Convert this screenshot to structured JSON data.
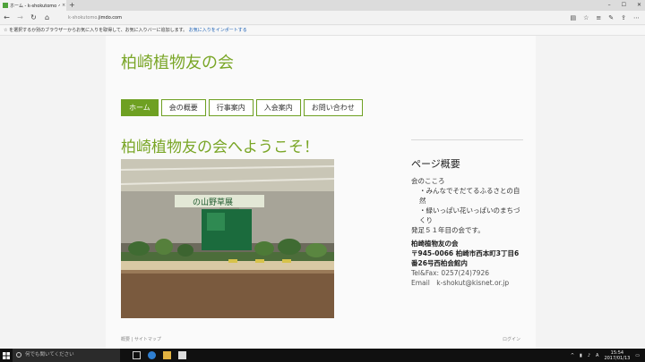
{
  "browser": {
    "tab_title": "ホーム - k-shokutomo ペ",
    "tab_close": "×",
    "new_tab": "+",
    "address_prefix": "k-shokutomo.",
    "address_domain": "jimdo.com",
    "favbar_text": "を選択するか別のブラウザーからお気に入りを取得して、お気に入りバーに追加します。",
    "favbar_link": "お気に入りをインポートする",
    "win_min": "–",
    "win_max": "☐",
    "win_close": "✕"
  },
  "site": {
    "title": "柏崎植物友の会",
    "menu": [
      "ホーム",
      "会の概要",
      "行事案内",
      "入会案内",
      "お問い合わせ"
    ],
    "heading": "柏崎植物友の会へようこそ！",
    "banner_text": "の山野草展"
  },
  "sidebar": {
    "title": "ページ概要",
    "lines": [
      "会のこころ",
      "・みんなでそだてるふるさとの自然",
      "・緑いっぱい花いっぱいのまちづくり",
      "発足５１年目の会です。"
    ],
    "org_name": "柏崎植物友の会",
    "org_address": "〒945-0066 柏崎市西本町3丁目6番26号西柏会館内",
    "tel": "Tel&Fax: 0257(24)7926",
    "email": "Email　k-shokut@kisnet.or.jp"
  },
  "footer": {
    "left": "概要 | サイトマップ",
    "right": "ログイン"
  },
  "taskbar": {
    "search_placeholder": "何でも聞いてください",
    "time": "15:54",
    "date": "2017/01/13"
  },
  "colors": {
    "accent": "#7aa627",
    "menu_border": "#6ea022",
    "taskbar": "#101010"
  }
}
